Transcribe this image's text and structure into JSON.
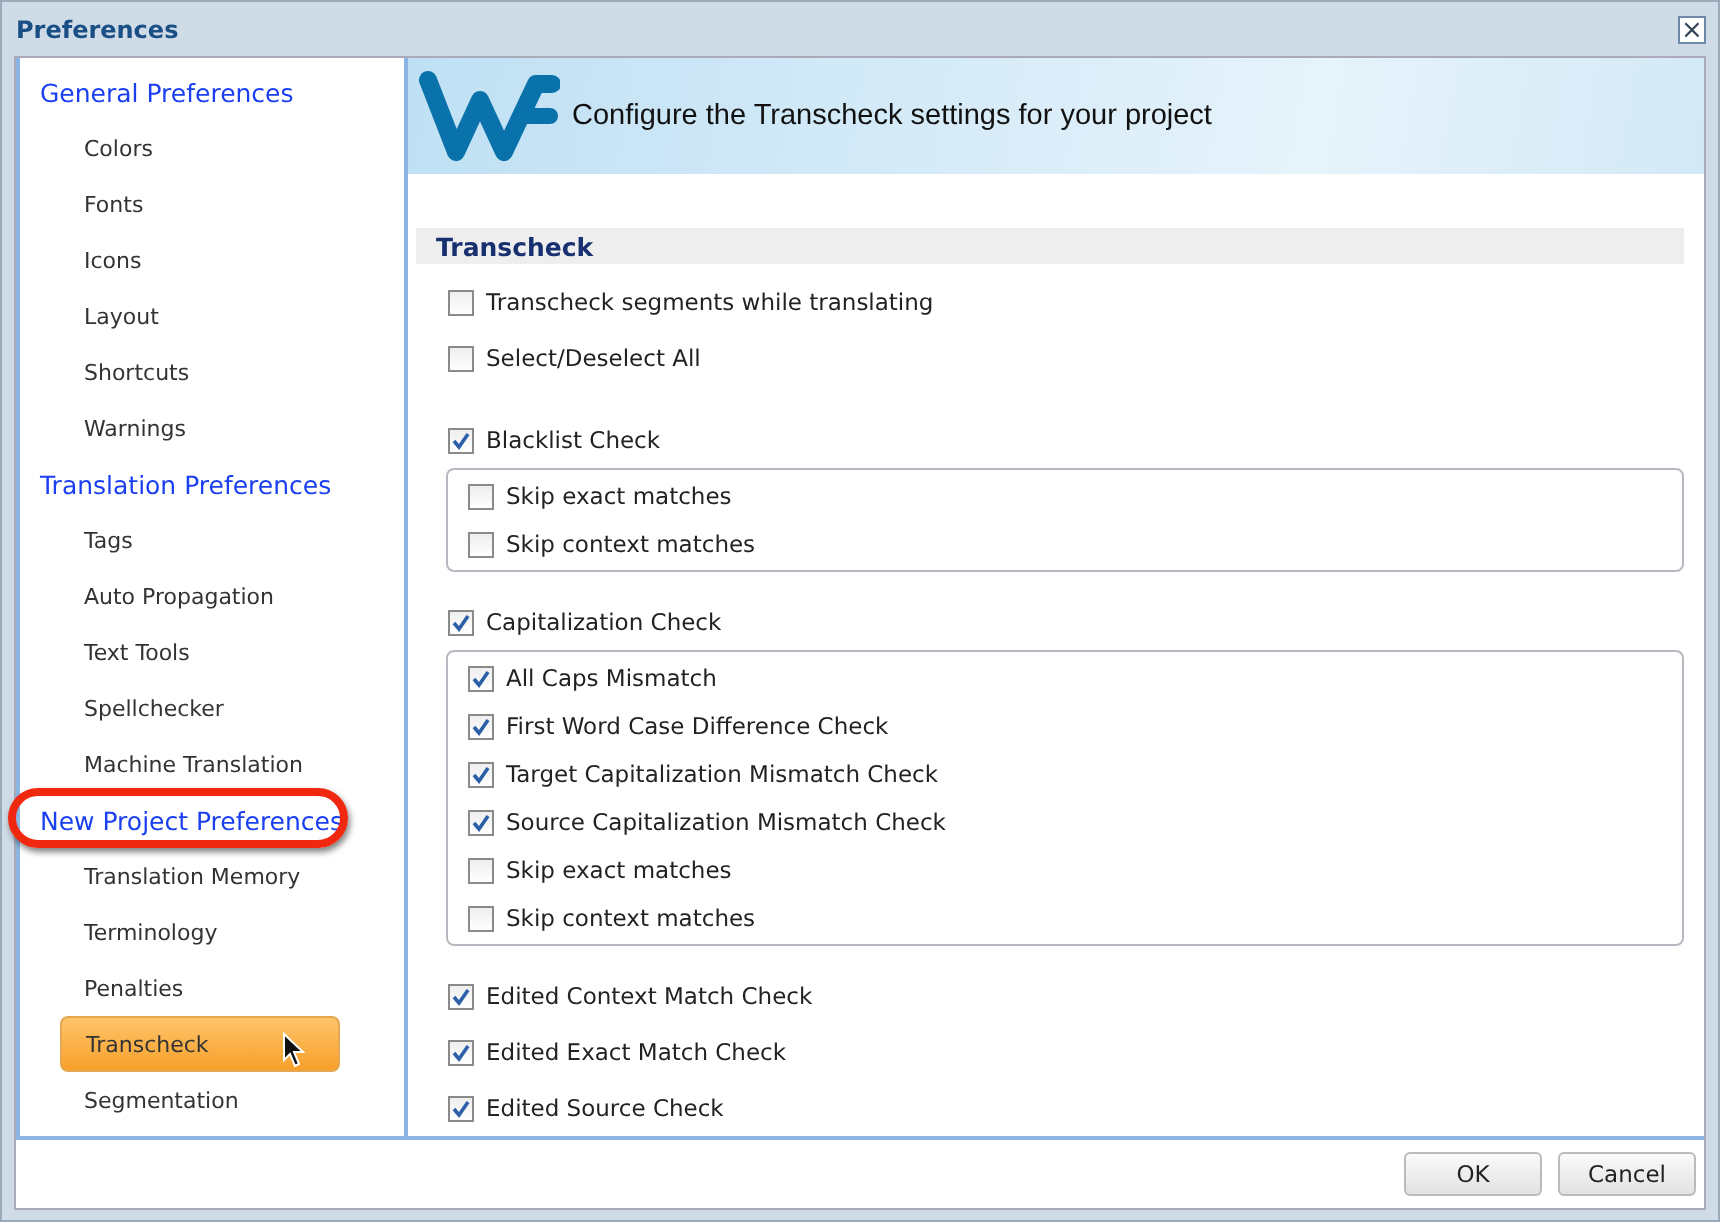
{
  "window": {
    "title": "Preferences",
    "close": "×"
  },
  "sidebar": {
    "sections": [
      {
        "label": "General Preferences",
        "circled": false,
        "items": [
          {
            "label": "Colors",
            "selected": false,
            "hovered": false
          },
          {
            "label": "Fonts",
            "selected": false,
            "hovered": false
          },
          {
            "label": "Icons",
            "selected": false,
            "hovered": false
          },
          {
            "label": "Layout",
            "selected": false,
            "hovered": false
          },
          {
            "label": "Shortcuts",
            "selected": false,
            "hovered": false
          },
          {
            "label": "Warnings",
            "selected": false,
            "hovered": false
          }
        ]
      },
      {
        "label": "Translation Preferences",
        "circled": false,
        "items": [
          {
            "label": "Tags",
            "selected": false,
            "hovered": false
          },
          {
            "label": "Auto Propagation",
            "selected": false,
            "hovered": false
          },
          {
            "label": "Text Tools",
            "selected": false,
            "hovered": false
          },
          {
            "label": "Spellchecker",
            "selected": false,
            "hovered": false
          },
          {
            "label": "Machine Translation",
            "selected": false,
            "hovered": false
          }
        ]
      },
      {
        "label": "New Project Preferences",
        "circled": true,
        "items": [
          {
            "label": "Translation Memory",
            "selected": false,
            "hovered": false
          },
          {
            "label": "Terminology",
            "selected": false,
            "hovered": false
          },
          {
            "label": "Penalties",
            "selected": false,
            "hovered": false
          },
          {
            "label": "Transcheck",
            "selected": true,
            "hovered": true
          },
          {
            "label": "Segmentation",
            "selected": false,
            "hovered": false
          }
        ]
      }
    ]
  },
  "banner": {
    "title": "Configure the Transcheck settings for your project"
  },
  "section": {
    "title": "Transcheck"
  },
  "checks": [
    {
      "label": "Transcheck segments while translating",
      "checked": false
    },
    {
      "label": "Select/Deselect All",
      "checked": false
    },
    {
      "label": "Blacklist Check",
      "checked": true,
      "options": [
        {
          "label": "Skip exact matches",
          "checked": false
        },
        {
          "label": "Skip context matches",
          "checked": false
        }
      ]
    },
    {
      "label": "Capitalization Check",
      "checked": true,
      "options": [
        {
          "label": "All Caps Mismatch",
          "checked": true
        },
        {
          "label": "First Word Case Difference Check",
          "checked": true
        },
        {
          "label": "Target Capitalization Mismatch Check",
          "checked": true
        },
        {
          "label": "Source Capitalization Mismatch Check",
          "checked": true
        },
        {
          "label": "Skip exact matches",
          "checked": false
        },
        {
          "label": "Skip context matches",
          "checked": false
        }
      ]
    },
    {
      "label": "Edited Context Match Check",
      "checked": true
    },
    {
      "label": "Edited Exact Match Check",
      "checked": true
    },
    {
      "label": "Edited Source Check",
      "checked": true
    }
  ],
  "buttons": [
    "OK",
    "Cancel"
  ]
}
